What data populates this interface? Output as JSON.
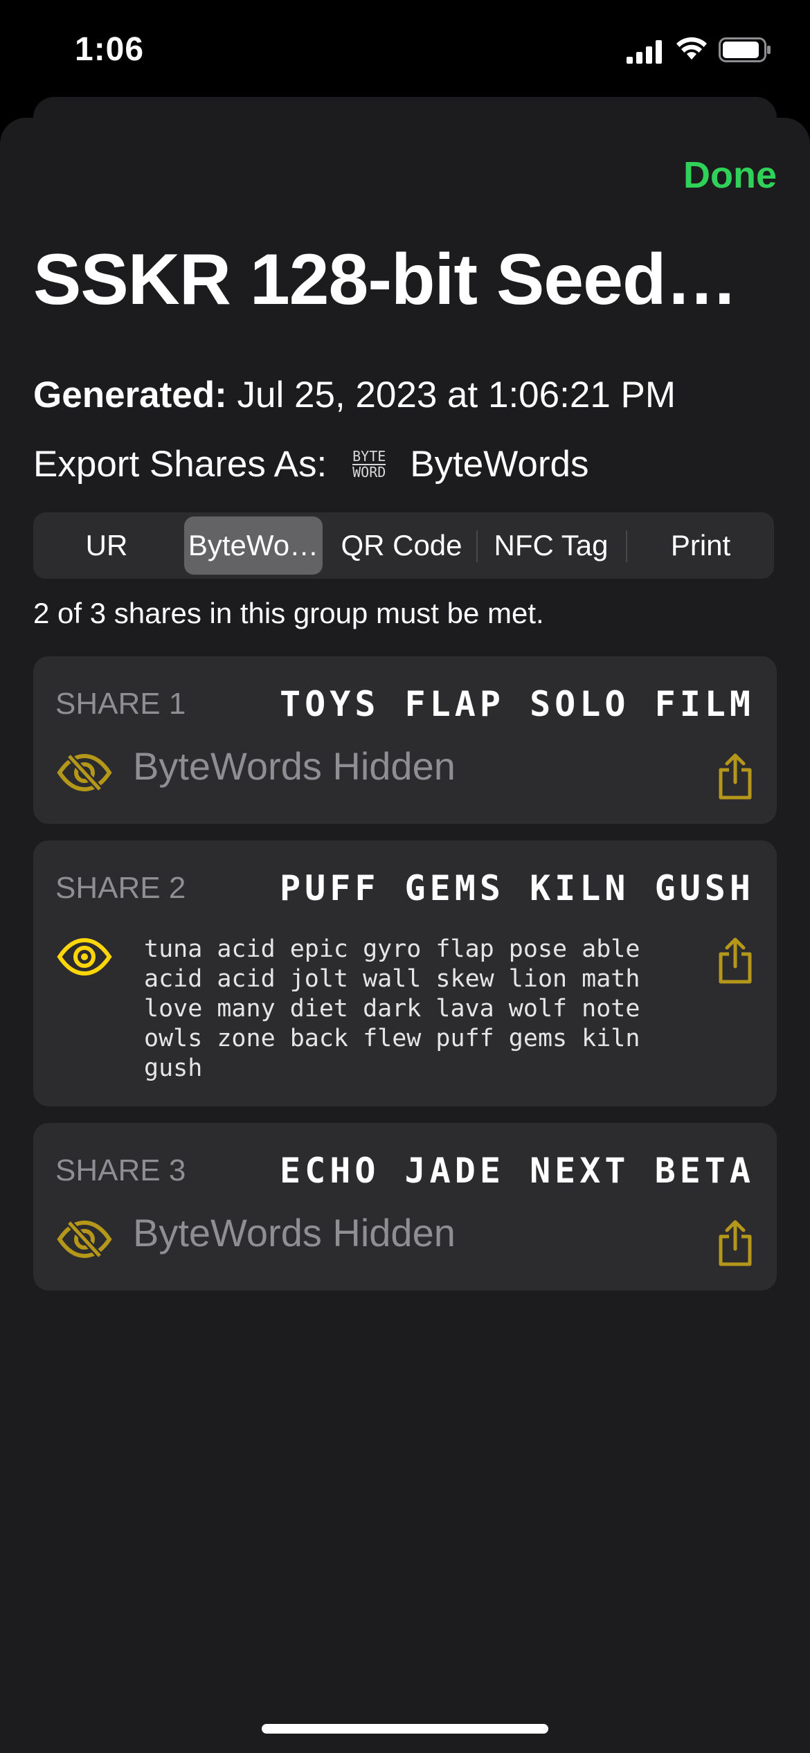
{
  "status": {
    "time": "1:06"
  },
  "nav": {
    "done_label": "Done"
  },
  "title": "SSKR 128-bit Seed…",
  "generated": {
    "label": "Generated:",
    "value": " Jul 25, 2023 at 1:06:21 PM"
  },
  "export": {
    "label": "Export Shares As:",
    "icon_top": "BYTE",
    "icon_bottom": "WORD",
    "value": "ByteWords"
  },
  "tabs": [
    "UR",
    "ByteWo…",
    "QR Code",
    "NFC Tag",
    "Print"
  ],
  "selected_tab": "ByteWo…",
  "group_rule": "2 of 3 shares in this group must be met.",
  "shares": [
    {
      "label": "SHARE 1",
      "words": "TOYS FLAP SOLO FILM",
      "hidden_text": "ByteWords Hidden",
      "visible": false
    },
    {
      "label": "SHARE 2",
      "words": "PUFF GEMS KILN GUSH",
      "visible": true,
      "bytewords": "tuna acid epic gyro flap pose able\nacid acid jolt wall skew lion math\nlove many diet dark lava wolf note\nowls zone back flew puff gems kiln\ngush"
    },
    {
      "label": "SHARE 3",
      "words": "ECHO JADE NEXT BETA",
      "hidden_text": "ByteWords Hidden",
      "visible": false
    }
  ],
  "colors": {
    "accent_green": "#30d158",
    "icon_yellow": "#ffd60a",
    "icon_yellow_dim": "#b5981a",
    "sheet_bg": "#1c1c1e",
    "card_bg": "#2c2c2e"
  },
  "icons": [
    "signal-icon",
    "wifi-icon",
    "battery-icon",
    "bytewords-icon",
    "eye-slash-icon",
    "eye-icon",
    "share-icon"
  ]
}
